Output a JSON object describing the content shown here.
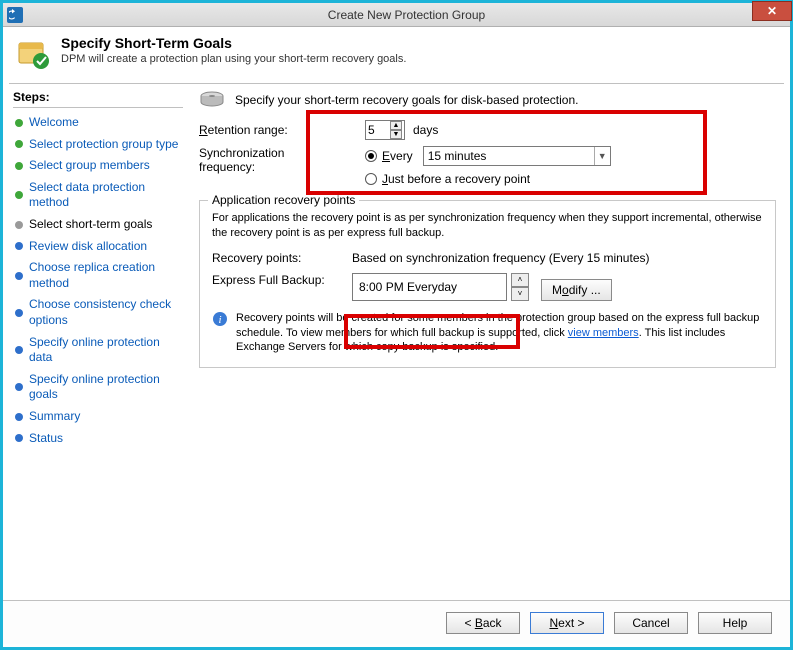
{
  "window": {
    "title": "Create New Protection Group",
    "close_glyph": "✕"
  },
  "header": {
    "title": "Specify Short-Term Goals",
    "subtitle": "DPM will create a protection plan using your short-term recovery goals."
  },
  "sidebar": {
    "heading": "Steps:",
    "items": [
      {
        "label": "Welcome"
      },
      {
        "label": "Select protection group type"
      },
      {
        "label": "Select group members"
      },
      {
        "label": "Select data protection method"
      },
      {
        "label": "Select short-term goals"
      },
      {
        "label": "Review disk allocation"
      },
      {
        "label": "Choose replica creation method"
      },
      {
        "label": "Choose consistency check options"
      },
      {
        "label": "Specify online protection data"
      },
      {
        "label": "Specify online protection goals"
      },
      {
        "label": "Summary"
      },
      {
        "label": "Status"
      }
    ]
  },
  "main": {
    "intro": "Specify your short-term recovery goals for disk-based protection.",
    "retention_label": "Retention range:",
    "retention_value": "5",
    "retention_unit": "days",
    "sync_label": "Synchronization frequency:",
    "sync_every_label": "Every",
    "sync_interval_value": "15 minutes",
    "sync_before_label": "Just before a recovery point"
  },
  "group": {
    "legend": "Application recovery points",
    "desc": "For applications the recovery point is as per synchronization frequency when they support incremental, otherwise the recovery point is as per express full backup.",
    "recovery_points_label": "Recovery points:",
    "recovery_points_value": "Based on synchronization frequency (Every 15 minutes)",
    "express_label": "Express Full Backup:",
    "express_value": "8:00 PM Everyday",
    "modify_label": "Modify ...",
    "info_text_1": "Recovery points will be created for some members in the protection group based on the express full backup schedule. To view members for which full backup is supported, click ",
    "info_link": "view members",
    "info_text_2": ". This list includes Exchange Servers for which copy backup is specified."
  },
  "footer": {
    "back": "< Back",
    "next": "Next >",
    "cancel": "Cancel",
    "help": "Help"
  }
}
